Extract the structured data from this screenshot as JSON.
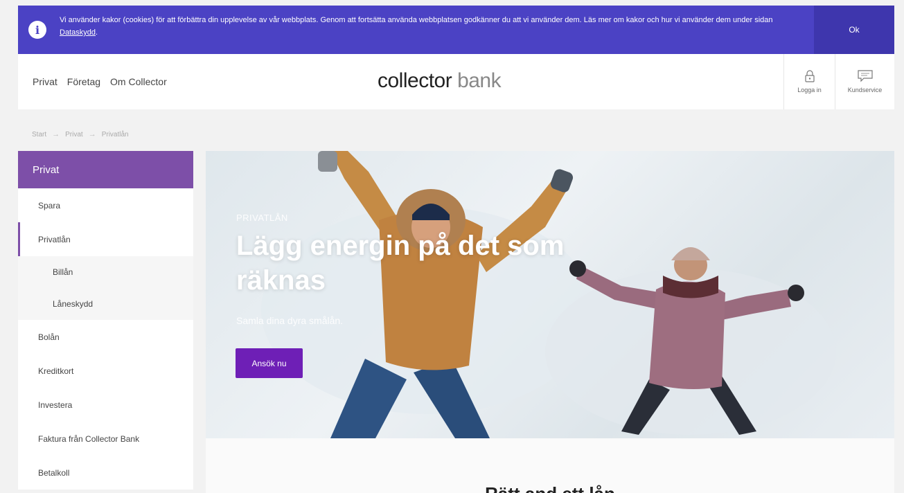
{
  "cookie_banner": {
    "text": "Vi använder kakor (cookies) för att förbättra din upplevelse av vår webbplats. Genom att fortsätta använda webbplatsen godkänner du att vi använder dem. Läs mer om kakor och hur vi använder dem under sidan ",
    "link_label": "Dataskydd",
    "suffix": ".",
    "ok_label": "Ok",
    "icon": "info-icon"
  },
  "header": {
    "nav": [
      "Privat",
      "Företag",
      "Om Collector"
    ],
    "logo_primary": "collector",
    "logo_secondary": "bank",
    "login_label": "Logga in",
    "login_icon": "lock-icon",
    "service_label": "Kundservice",
    "service_icon": "chat-bubble-icon"
  },
  "breadcrumb": {
    "items": [
      "Start",
      "Privat",
      "Privatlån"
    ],
    "separator": "→"
  },
  "sidebar": {
    "heading": "Privat",
    "items": [
      {
        "label": "Spara"
      },
      {
        "label": "Privatlån"
      },
      {
        "label": "Billån"
      },
      {
        "label": "Låneskydd"
      },
      {
        "label": "Bolån"
      },
      {
        "label": "Kreditkort"
      },
      {
        "label": "Investera"
      },
      {
        "label": "Faktura från Collector Bank"
      },
      {
        "label": "Betalkoll"
      }
    ]
  },
  "hero": {
    "kicker": "PRIVATLÅN",
    "title": "Lägg energin på det som räknas",
    "lead": "Samla dina dyra smålån.",
    "cta_label": "Ansök nu"
  },
  "content": {
    "peek_heading": "Rätt and ett lån"
  },
  "colors": {
    "banner": "#4b42c4",
    "sidebar_head": "#7d4fa8",
    "cta": "#6e1fb6"
  }
}
